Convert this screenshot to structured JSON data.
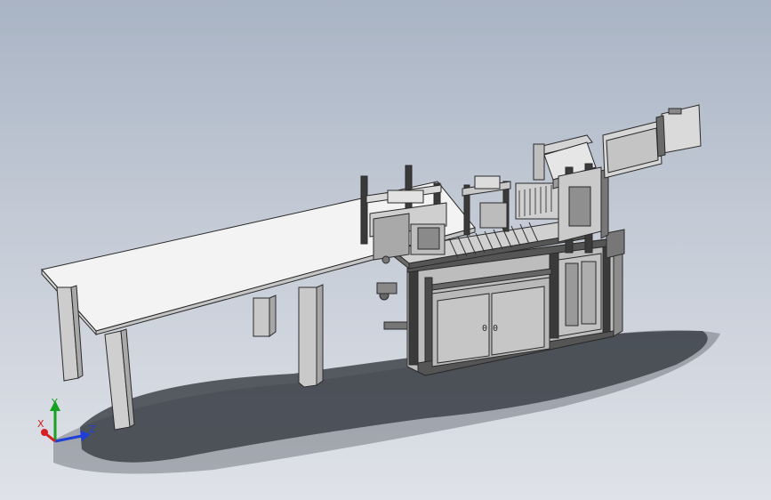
{
  "view": {
    "background_top": "#a9b4c4",
    "background_bottom": "#dfe2e8",
    "model_line_color": "#2a2a2a",
    "table_top_color": "#f3f3f3",
    "leg_color": "#c9c9c9",
    "shadow_color": "#2b2f36",
    "panel_gray": "#bdbdbd",
    "dark_frame": "#3a3a3a"
  },
  "triad": {
    "x_label": "X",
    "y_label": "Y",
    "z_label": "Z",
    "x_color": "#d42020",
    "y_color": "#18a020",
    "z_color": "#1f3fd8"
  },
  "cabinet": {
    "door_text": "0 0"
  }
}
